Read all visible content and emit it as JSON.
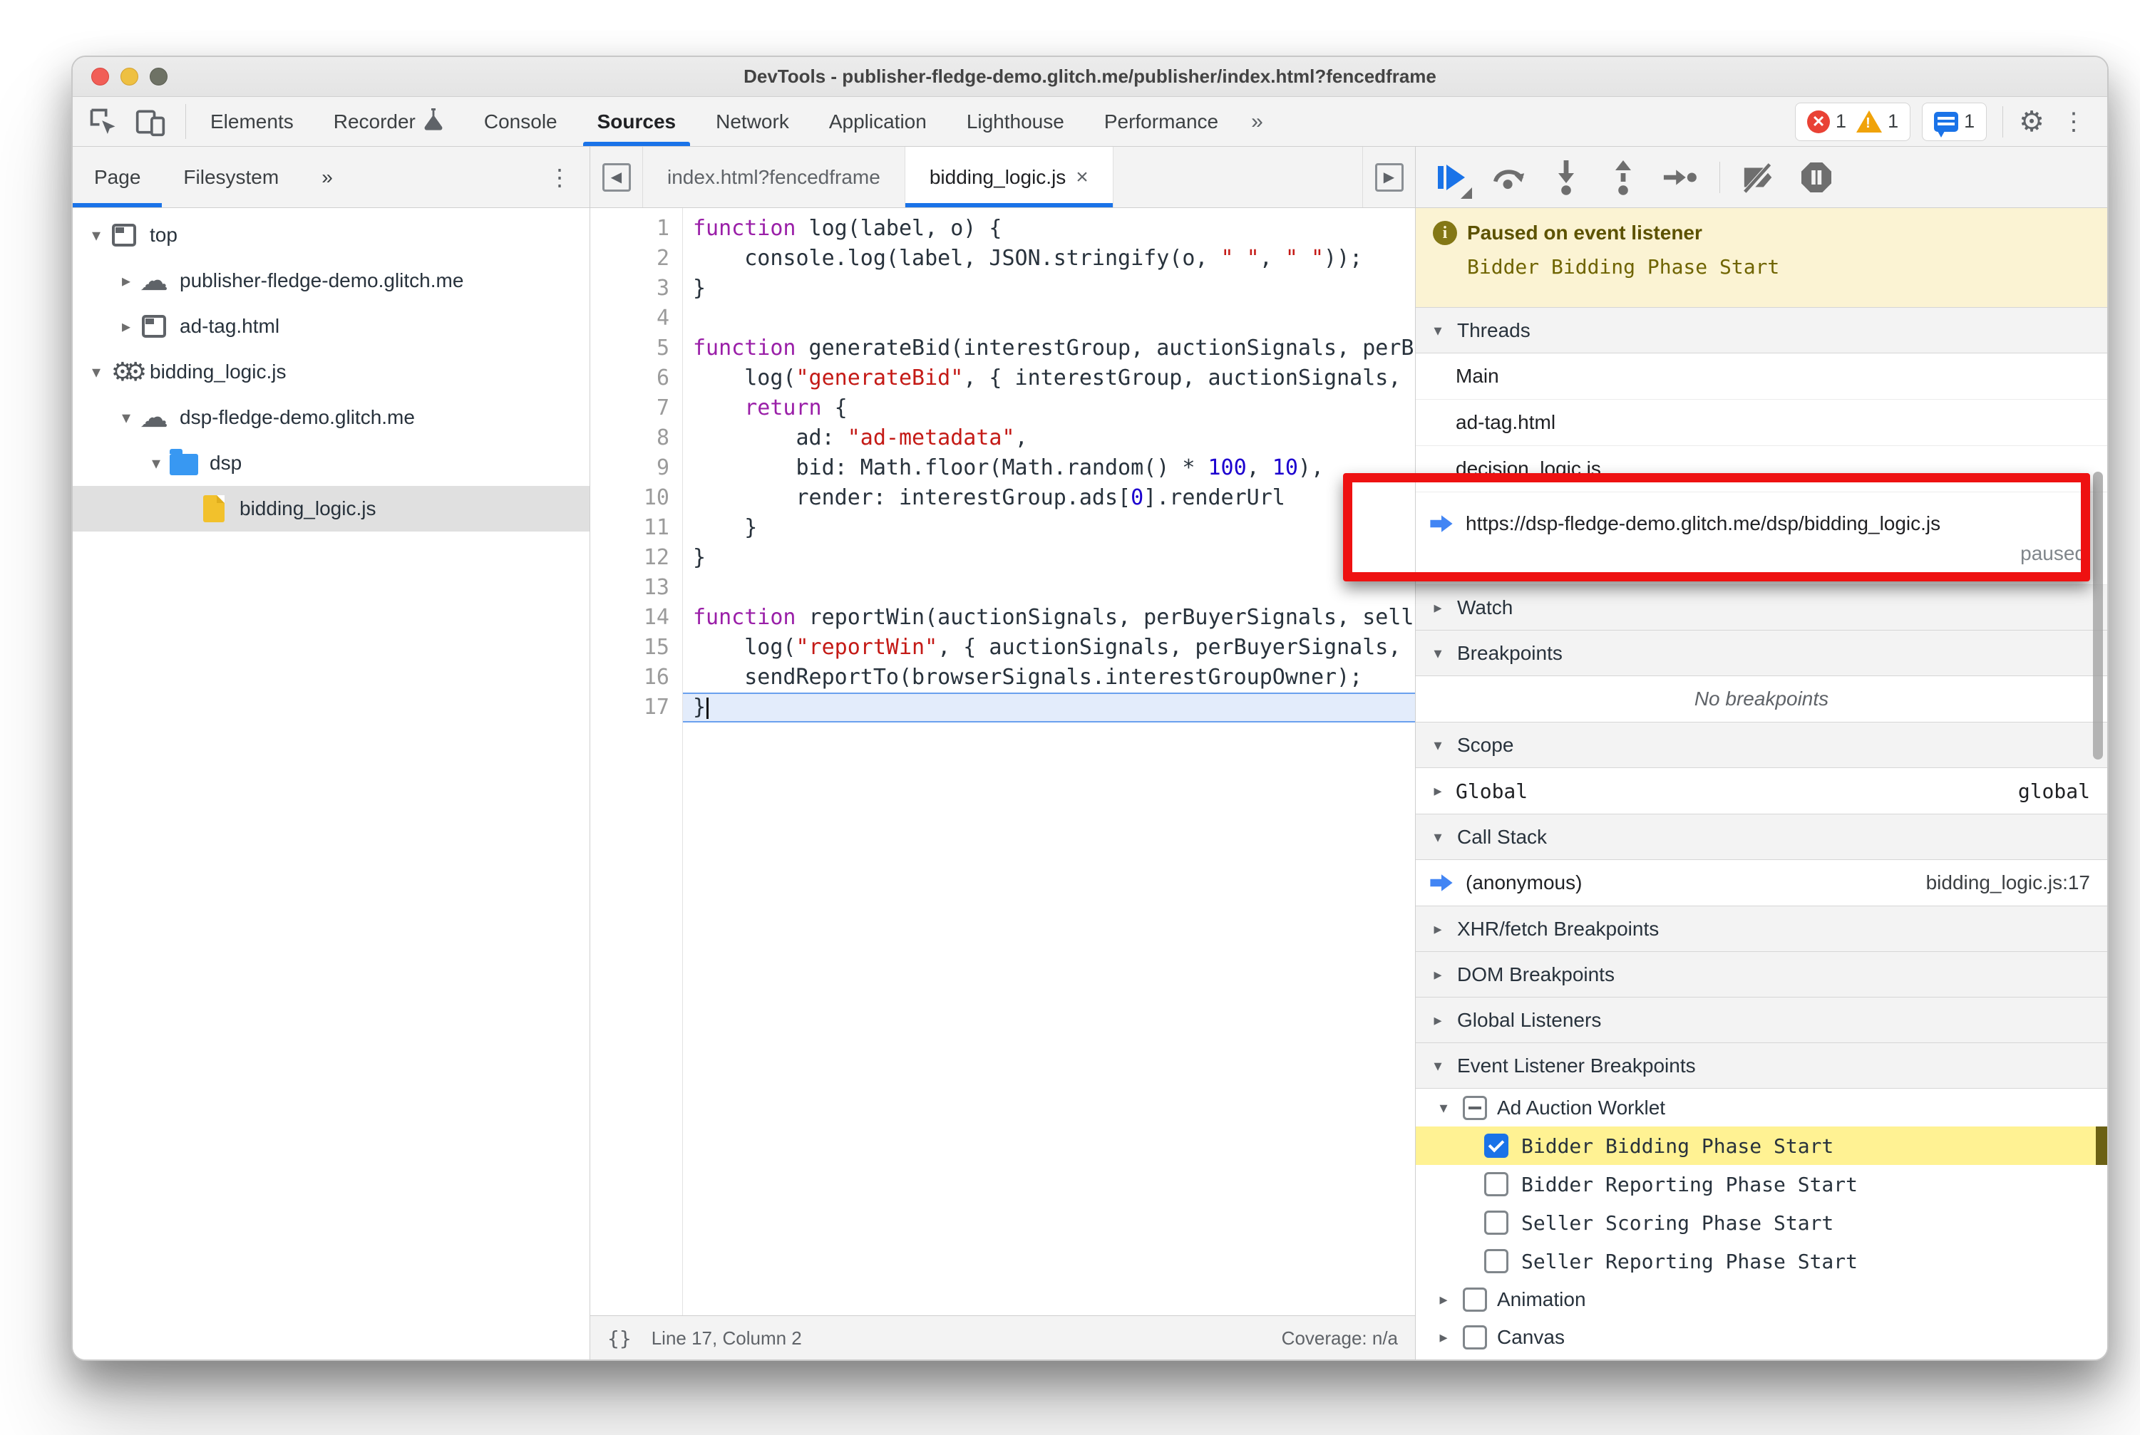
{
  "window": {
    "title": "DevTools - publisher-fledge-demo.glitch.me/publisher/index.html?fencedframe"
  },
  "toolbar": {
    "tabs": [
      {
        "label": "Elements",
        "active": false,
        "icon": null
      },
      {
        "label": "Recorder",
        "active": false,
        "icon": "flask"
      },
      {
        "label": "Console",
        "active": false,
        "icon": null
      },
      {
        "label": "Sources",
        "active": true,
        "icon": null
      },
      {
        "label": "Network",
        "active": false,
        "icon": null
      },
      {
        "label": "Application",
        "active": false,
        "icon": null
      },
      {
        "label": "Lighthouse",
        "active": false,
        "icon": null
      },
      {
        "label": "Performance",
        "active": false,
        "icon": null
      }
    ],
    "more_tabs_label": "»",
    "error_count": "1",
    "warning_count": "1",
    "issues_count": "1",
    "kebab_glyph": "⋮"
  },
  "left_panel": {
    "tabs": [
      {
        "label": "Page",
        "active": true
      },
      {
        "label": "Filesystem",
        "active": false
      }
    ],
    "more_label": "»",
    "kebab_glyph": "⋮",
    "tree": [
      {
        "label": "top",
        "icon": "frame",
        "expander": "open",
        "depth": 0,
        "selected": false
      },
      {
        "label": "publisher-fledge-demo.glitch.me",
        "icon": "cloud",
        "expander": "closed",
        "depth": 1,
        "selected": false
      },
      {
        "label": "ad-tag.html",
        "icon": "frame",
        "expander": "closed",
        "depth": 1,
        "selected": false
      },
      {
        "label": "bidding_logic.js",
        "icon": "worklet",
        "expander": "open",
        "depth": 0,
        "selected": false
      },
      {
        "label": "dsp-fledge-demo.glitch.me",
        "icon": "cloud",
        "expander": "open",
        "depth": 1,
        "selected": false
      },
      {
        "label": "dsp",
        "icon": "folder",
        "expander": "open",
        "depth": 2,
        "selected": false
      },
      {
        "label": "bidding_logic.js",
        "icon": "file",
        "expander": "none",
        "depth": 3,
        "selected": true
      }
    ]
  },
  "editor": {
    "tabs": [
      {
        "label": "index.html?fencedframe",
        "active": false,
        "closable": false
      },
      {
        "label": "bidding_logic.js",
        "active": true,
        "closable": true
      }
    ],
    "close_glyph": "×",
    "status": {
      "braces": "{}",
      "line_col": "Line 17, Column 2",
      "coverage": "Coverage: n/a"
    },
    "paused_line": 17,
    "lines": [
      [
        {
          "t": "k",
          "v": "function"
        },
        {
          "t": "p",
          "v": " log(label, o) {"
        }
      ],
      [
        {
          "t": "p",
          "v": "    console.log(label, JSON.stringify(o, "
        },
        {
          "t": "s",
          "v": "\" \""
        },
        {
          "t": "p",
          "v": ", "
        },
        {
          "t": "s",
          "v": "\" \""
        },
        {
          "t": "p",
          "v": "));"
        }
      ],
      [
        {
          "t": "p",
          "v": "}"
        }
      ],
      [],
      [
        {
          "t": "k",
          "v": "function"
        },
        {
          "t": "p",
          "v": " generateBid(interestGroup, auctionSignals, perBuyerSignals, trustedBiddingSignals, browserSignals) {"
        }
      ],
      [
        {
          "t": "p",
          "v": "    log("
        },
        {
          "t": "s",
          "v": "\"generateBid\""
        },
        {
          "t": "p",
          "v": ", { interestGroup, auctionSignals, perBuyerSignals, trustedBiddingSignals });"
        }
      ],
      [
        {
          "t": "p",
          "v": "    "
        },
        {
          "t": "k",
          "v": "return"
        },
        {
          "t": "p",
          "v": " {"
        }
      ],
      [
        {
          "t": "p",
          "v": "        ad: "
        },
        {
          "t": "s",
          "v": "\"ad-metadata\""
        },
        {
          "t": "p",
          "v": ","
        }
      ],
      [
        {
          "t": "p",
          "v": "        bid: Math.floor(Math.random() * "
        },
        {
          "t": "n",
          "v": "100"
        },
        {
          "t": "p",
          "v": ", "
        },
        {
          "t": "n",
          "v": "10"
        },
        {
          "t": "p",
          "v": "),"
        }
      ],
      [
        {
          "t": "p",
          "v": "        render: interestGroup.ads["
        },
        {
          "t": "n",
          "v": "0"
        },
        {
          "t": "p",
          "v": "].renderUrl"
        }
      ],
      [
        {
          "t": "p",
          "v": "    }"
        }
      ],
      [
        {
          "t": "p",
          "v": "}"
        }
      ],
      [],
      [
        {
          "t": "k",
          "v": "function"
        },
        {
          "t": "p",
          "v": " reportWin(auctionSignals, perBuyerSignals, sellerSignals, browserSignals) {"
        }
      ],
      [
        {
          "t": "p",
          "v": "    log("
        },
        {
          "t": "s",
          "v": "\"reportWin\""
        },
        {
          "t": "p",
          "v": ", { auctionSignals, perBuyerSignals, sellerSignals, browserSignals });"
        }
      ],
      [
        {
          "t": "p",
          "v": "    sendReportTo(browserSignals.interestGroupOwner);"
        }
      ],
      [
        {
          "t": "p",
          "v": "}"
        }
      ]
    ]
  },
  "debugger": {
    "paused_banner": {
      "title": "Paused on event listener",
      "message": "Bidder Bidding Phase Start"
    },
    "threads": {
      "header": "Threads",
      "items": [
        {
          "label": "Main",
          "active": false,
          "status": null
        },
        {
          "label": "ad-tag.html",
          "active": false,
          "status": null
        },
        {
          "label": "decision_logic.js",
          "active": false,
          "status": null
        },
        {
          "label": "https://dsp-fledge-demo.glitch.me/dsp/bidding_logic.js",
          "active": true,
          "status": "paused"
        }
      ]
    },
    "watch": {
      "header": "Watch"
    },
    "breakpoints": {
      "header": "Breakpoints",
      "empty_text": "No breakpoints"
    },
    "scope": {
      "header": "Scope",
      "rows": [
        {
          "label": "Global",
          "value": "global"
        }
      ]
    },
    "call_stack": {
      "header": "Call Stack",
      "frames": [
        {
          "label": "(anonymous)",
          "location": "bidding_logic.js:17",
          "active": true
        }
      ]
    },
    "xhr_breakpoints": {
      "header": "XHR/fetch Breakpoints"
    },
    "dom_breakpoints": {
      "header": "DOM Breakpoints"
    },
    "global_listeners": {
      "header": "Global Listeners"
    },
    "event_listener_breakpoints": {
      "header": "Event Listener Breakpoints",
      "groups": [
        {
          "label": "Ad Auction Worklet",
          "state": "indet",
          "expanded": true,
          "children": [
            {
              "label": "Bidder Bidding Phase Start",
              "checked": true,
              "highlighted": true
            },
            {
              "label": "Bidder Reporting Phase Start",
              "checked": false,
              "highlighted": false
            },
            {
              "label": "Seller Scoring Phase Start",
              "checked": false,
              "highlighted": false
            },
            {
              "label": "Seller Reporting Phase Start",
              "checked": false,
              "highlighted": false
            }
          ]
        },
        {
          "label": "Animation",
          "state": "unchecked",
          "expanded": false,
          "children": []
        },
        {
          "label": "Canvas",
          "state": "unchecked",
          "expanded": false,
          "children": []
        }
      ]
    }
  },
  "colors": {
    "accent_blue": "#1a73e8",
    "exec_arrow_blue": "#4285f4",
    "keyword": "#9a1fa8",
    "string": "#c41a16",
    "number": "#1c00cf",
    "paused_banner_bg": "#fbf3d3",
    "highlight_row_yellow": "#fff293",
    "annotation_red": "#ee1111"
  },
  "glyphs": {
    "open_triangle": "▾",
    "closed_triangle": "▸",
    "cloud": "☁",
    "gear": "⚙"
  }
}
